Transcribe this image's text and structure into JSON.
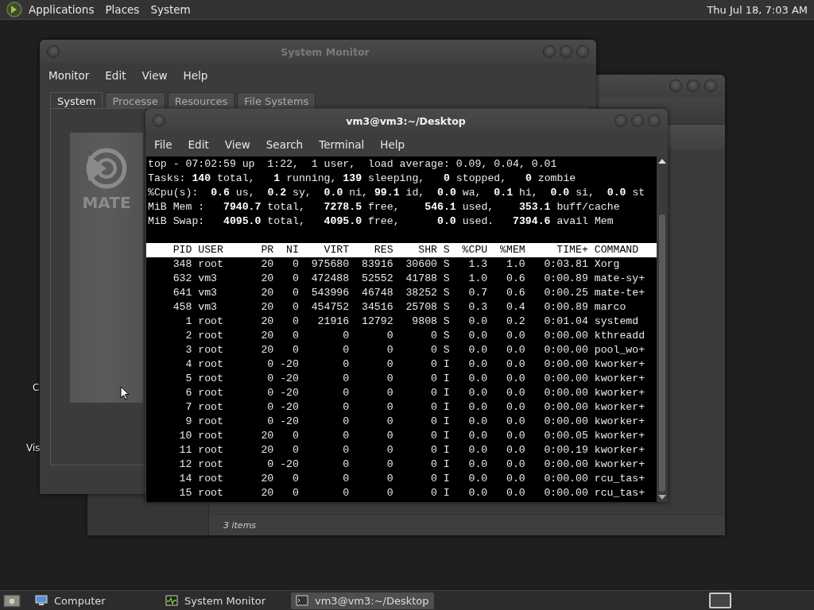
{
  "top_panel": {
    "menus": [
      "Applications",
      "Places",
      "System"
    ],
    "clock": "Thu Jul 18, 7:03 AM"
  },
  "desktop_icons": [
    {
      "label": "C"
    },
    {
      "label": "Vis"
    }
  ],
  "file_manager": {
    "status": "3 items"
  },
  "system_monitor": {
    "title": "System Monitor",
    "menus": [
      "Monitor",
      "Edit",
      "View",
      "Help"
    ],
    "tabs": [
      {
        "label": "System",
        "selected": true
      },
      {
        "label": "Processe",
        "selected": false
      },
      {
        "label": "Resources",
        "selected": false
      },
      {
        "label": "File Systems",
        "selected": false
      }
    ],
    "logo_text": "MATE"
  },
  "terminal": {
    "title": "vm3@vm3:~/Desktop",
    "menus": [
      "File",
      "Edit",
      "View",
      "Search",
      "Terminal",
      "Help"
    ],
    "summary": [
      "top - 07:02:59 up  1:22,  1 user,  load average: 0.09, 0.04, 0.01",
      "Tasks: **140** total,   **1** running, **139** sleeping,   **0** stopped,   **0** zombie",
      "%Cpu(s):  **0.6** us,  **0.2** sy,  **0.0** ni, **99.1** id,  **0.0** wa,  **0.1** hi,  **0.0** si,  **0.0** st",
      "MiB Mem :   **7940.7** total,   **7278.5** free,    **546.1** used,    **353.1** buff/cache",
      "MiB Swap:   **4095.0** total,   **4095.0** free,      **0.0** used.   **7394.6** avail Mem"
    ],
    "columns": [
      "PID",
      "USER",
      "PR",
      "NI",
      "VIRT",
      "RES",
      "SHR",
      "S",
      "%CPU",
      "%MEM",
      "TIME+",
      "COMMAND"
    ],
    "processes": [
      [
        "348",
        "root",
        "20",
        "0",
        "975680",
        "83916",
        "30600",
        "S",
        "1.3",
        "1.0",
        "0:03.81",
        "Xorg"
      ],
      [
        "632",
        "vm3",
        "20",
        "0",
        "472488",
        "52552",
        "41788",
        "S",
        "1.0",
        "0.6",
        "0:00.89",
        "mate-sy+"
      ],
      [
        "641",
        "vm3",
        "20",
        "0",
        "543996",
        "46748",
        "38252",
        "S",
        "0.7",
        "0.6",
        "0:00.25",
        "mate-te+"
      ],
      [
        "458",
        "vm3",
        "20",
        "0",
        "454752",
        "34516",
        "25708",
        "S",
        "0.3",
        "0.4",
        "0:00.89",
        "marco"
      ],
      [
        "1",
        "root",
        "20",
        "0",
        "21916",
        "12792",
        "9808",
        "S",
        "0.0",
        "0.2",
        "0:01.04",
        "systemd"
      ],
      [
        "2",
        "root",
        "20",
        "0",
        "0",
        "0",
        "0",
        "S",
        "0.0",
        "0.0",
        "0:00.00",
        "kthreadd"
      ],
      [
        "3",
        "root",
        "20",
        "0",
        "0",
        "0",
        "0",
        "S",
        "0.0",
        "0.0",
        "0:00.00",
        "pool_wo+"
      ],
      [
        "4",
        "root",
        "0",
        "-20",
        "0",
        "0",
        "0",
        "I",
        "0.0",
        "0.0",
        "0:00.00",
        "kworker+"
      ],
      [
        "5",
        "root",
        "0",
        "-20",
        "0",
        "0",
        "0",
        "I",
        "0.0",
        "0.0",
        "0:00.00",
        "kworker+"
      ],
      [
        "6",
        "root",
        "0",
        "-20",
        "0",
        "0",
        "0",
        "I",
        "0.0",
        "0.0",
        "0:00.00",
        "kworker+"
      ],
      [
        "7",
        "root",
        "0",
        "-20",
        "0",
        "0",
        "0",
        "I",
        "0.0",
        "0.0",
        "0:00.00",
        "kworker+"
      ],
      [
        "9",
        "root",
        "0",
        "-20",
        "0",
        "0",
        "0",
        "I",
        "0.0",
        "0.0",
        "0:00.00",
        "kworker+"
      ],
      [
        "10",
        "root",
        "20",
        "0",
        "0",
        "0",
        "0",
        "I",
        "0.0",
        "0.0",
        "0:00.05",
        "kworker+"
      ],
      [
        "11",
        "root",
        "20",
        "0",
        "0",
        "0",
        "0",
        "I",
        "0.0",
        "0.0",
        "0:00.19",
        "kworker+"
      ],
      [
        "12",
        "root",
        "0",
        "-20",
        "0",
        "0",
        "0",
        "I",
        "0.0",
        "0.0",
        "0:00.00",
        "kworker+"
      ],
      [
        "14",
        "root",
        "20",
        "0",
        "0",
        "0",
        "0",
        "I",
        "0.0",
        "0.0",
        "0:00.00",
        "rcu_tas+"
      ],
      [
        "15",
        "root",
        "20",
        "0",
        "0",
        "0",
        "0",
        "I",
        "0.0",
        "0.0",
        "0:00.00",
        "rcu_tas+"
      ]
    ]
  },
  "taskbar": {
    "items": [
      {
        "kind": "computer",
        "label": "Computer",
        "selected": false
      },
      {
        "kind": "monitor",
        "label": "System Monitor",
        "selected": false
      },
      {
        "kind": "terminal",
        "label": "vm3@vm3:~/Desktop",
        "selected": true
      }
    ]
  }
}
